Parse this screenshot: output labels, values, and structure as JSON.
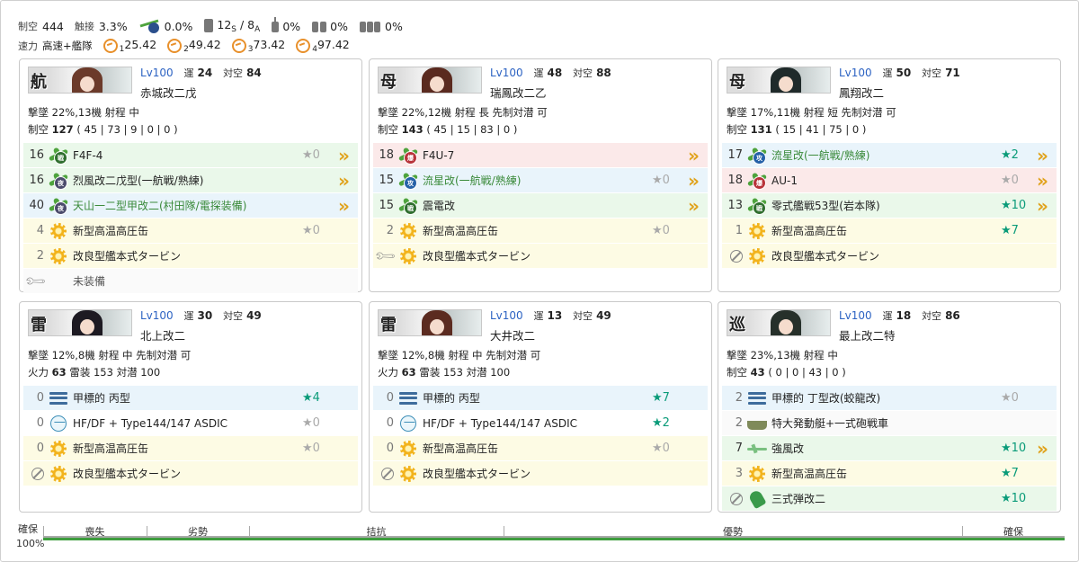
{
  "summary": {
    "air_label": "制空",
    "air": "444",
    "contact_label": "触接",
    "contact": "3.3%",
    "aa_icon_pct": "0.0%",
    "tp_pre": "12",
    "tp_s": "S",
    "tp_mid": "/ 8",
    "tp_a": "A",
    "drum1": "0%",
    "drum2": "0%",
    "drum3": "0%",
    "speed_label": "速力",
    "speed": "高速+艦隊",
    "ae": [
      {
        "i": "1",
        "v": "25.42"
      },
      {
        "i": "2",
        "v": "49.42"
      },
      {
        "i": "3",
        "v": "73.42"
      },
      {
        "i": "4",
        "v": "97.42"
      }
    ]
  },
  "ships": [
    {
      "banner": "航",
      "face": "#6b3a2a",
      "lv": "Lv100",
      "luck_k": "運",
      "luck": "24",
      "aa_k": "対空",
      "aa": "84",
      "name": "赤城改二戊",
      "line1": "撃墜 22%,13機  射程 中",
      "line2_k": "制空",
      "line2_v": "127",
      "line2_rest": "( 45 | 73 | 9 | 0 | 0 )",
      "slots": [
        {
          "c": "16",
          "icon": "plane",
          "badge": "戦",
          "bc": "g",
          "name": "F4F-4",
          "star": "★0",
          "sc": "gray",
          "chev": "»",
          "bg": "g"
        },
        {
          "c": "16",
          "icon": "plane",
          "badge": "夜戦",
          "bc": "k",
          "name": "烈風改二戊型(一航戦/熟練)",
          "star": "",
          "sc": "gray",
          "chev": "»",
          "bg": "g"
        },
        {
          "c": "40",
          "icon": "plane",
          "badge": "夜攻",
          "bc": "k",
          "name": "天山一二型甲改二(村田隊/電探装備)",
          "green": true,
          "star": "",
          "sc": "gray",
          "chev": "»",
          "bg": "b"
        },
        {
          "c": "4",
          "icon": "gear",
          "name": "新型高温高圧缶",
          "star": "★0",
          "sc": "gray",
          "chev": "",
          "bg": "y",
          "muted": true
        },
        {
          "c": "2",
          "icon": "gear",
          "name": "改良型艦本式タービン",
          "star": "",
          "sc": "gray",
          "chev": "",
          "bg": "y",
          "muted": true
        },
        {
          "c": "",
          "icon": "wrench",
          "name": "未装備",
          "star": "",
          "sc": "gray",
          "chev": "",
          "bg": "w",
          "empty": true
        }
      ]
    },
    {
      "banner": "母",
      "face": "#5a2a1f",
      "lv": "Lv100",
      "luck_k": "運",
      "luck": "48",
      "aa_k": "対空",
      "aa": "88",
      "name": "瑞鳳改二乙",
      "line1": "撃墜 22%,12機  射程 長  先制対潜 可",
      "line2_k": "制空",
      "line2_v": "143",
      "line2_rest": "( 45 | 15 | 83 | 0 )",
      "slots": [
        {
          "c": "18",
          "icon": "plane",
          "badge": "爆",
          "bc": "r",
          "name": "F4U-7",
          "star": "",
          "sc": "gray",
          "chev": "»",
          "bg": "r"
        },
        {
          "c": "15",
          "icon": "plane",
          "badge": "攻",
          "bc": "b",
          "name": "流星改(一航戦/熟練)",
          "green": true,
          "star": "★0",
          "sc": "gray",
          "chev": "»",
          "bg": "b"
        },
        {
          "c": "15",
          "icon": "plane",
          "badge": "戦",
          "bc": "g",
          "name": "震電改",
          "star": "",
          "sc": "gray",
          "chev": "»",
          "bg": "g"
        },
        {
          "c": "2",
          "icon": "gear",
          "name": "新型高温高圧缶",
          "star": "★0",
          "sc": "gray",
          "chev": "",
          "bg": "y",
          "muted": true
        },
        {
          "c": "",
          "icon": "wrench",
          "name": "改良型艦本式タービン",
          "star": "",
          "sc": "gray",
          "chev": "",
          "bg": "y"
        }
      ]
    },
    {
      "banner": "母",
      "face": "#1f2a2a",
      "lv": "Lv100",
      "luck_k": "運",
      "luck": "50",
      "aa_k": "対空",
      "aa": "71",
      "name": "鳳翔改二",
      "line1": "撃墜 17%,11機  射程 短  先制対潜 可",
      "line2_k": "制空",
      "line2_v": "131",
      "line2_rest": "( 15 | 41 | 75 | 0 )",
      "slots": [
        {
          "c": "17",
          "icon": "plane",
          "badge": "攻",
          "bc": "b",
          "name": "流星改(一航戦/熟練)",
          "green": true,
          "star": "★2",
          "sc": "teal",
          "chev": "»",
          "bg": "b"
        },
        {
          "c": "18",
          "icon": "plane",
          "badge": "爆",
          "bc": "r",
          "name": "AU-1",
          "star": "★0",
          "sc": "gray",
          "chev": "»",
          "bg": "r"
        },
        {
          "c": "13",
          "icon": "plane",
          "badge": "戦",
          "bc": "g",
          "name": "零式艦戦53型(岩本隊)",
          "star": "★10",
          "sc": "teal",
          "chev": "»",
          "bg": "g"
        },
        {
          "c": "1",
          "icon": "gear",
          "name": "新型高温高圧缶",
          "star": "★7",
          "sc": "teal",
          "chev": "",
          "bg": "y",
          "muted": true
        },
        {
          "c": "",
          "icon": "noentry",
          "name": "改良型艦本式タービン",
          "star": "",
          "sc": "gray",
          "chev": "",
          "bg": "y"
        }
      ]
    },
    {
      "banner": "雷",
      "face": "#1d1a22",
      "lv": "Lv100",
      "luck_k": "運",
      "luck": "30",
      "aa_k": "対空",
      "aa": "49",
      "name": "北上改二",
      "line1": "撃墜 12%,8機  射程 中  先制対潜 可",
      "line2_k": "火力",
      "line2_v": "63",
      "line2_rest": "雷装 153  対潜 100",
      "slots": [
        {
          "c": "0",
          "icon": "depth",
          "name": "甲標的 丙型",
          "star": "★4",
          "sc": "teal",
          "chev": "",
          "bg": "b",
          "muted": true
        },
        {
          "c": "0",
          "icon": "sonar",
          "name": "HF/DF + Type144/147 ASDIC",
          "star": "★0",
          "sc": "gray",
          "chev": "",
          "bg": "n",
          "muted": true
        },
        {
          "c": "0",
          "icon": "gear",
          "name": "新型高温高圧缶",
          "star": "★0",
          "sc": "gray",
          "chev": "",
          "bg": "y",
          "muted": true
        },
        {
          "c": "",
          "icon": "noentry",
          "name": "改良型艦本式タービン",
          "star": "",
          "sc": "gray",
          "chev": "",
          "bg": "y"
        }
      ]
    },
    {
      "banner": "雷",
      "face": "#5b2b20",
      "lv": "Lv100",
      "luck_k": "運",
      "luck": "13",
      "aa_k": "対空",
      "aa": "49",
      "name": "大井改二",
      "line1": "撃墜 12%,8機  射程 中  先制対潜 可",
      "line2_k": "火力",
      "line2_v": "63",
      "line2_rest": "雷装 153  対潜 100",
      "slots": [
        {
          "c": "0",
          "icon": "depth",
          "name": "甲標的 丙型",
          "star": "★7",
          "sc": "teal",
          "chev": "",
          "bg": "b",
          "muted": true
        },
        {
          "c": "0",
          "icon": "sonar",
          "name": "HF/DF + Type144/147 ASDIC",
          "star": "★2",
          "sc": "teal",
          "chev": "",
          "bg": "n",
          "muted": true
        },
        {
          "c": "0",
          "icon": "gear",
          "name": "新型高温高圧缶",
          "star": "★0",
          "sc": "gray",
          "chev": "",
          "bg": "y",
          "muted": true
        },
        {
          "c": "",
          "icon": "noentry",
          "name": "改良型艦本式タービン",
          "star": "",
          "sc": "gray",
          "chev": "",
          "bg": "y"
        }
      ]
    },
    {
      "banner": "巡",
      "face": "#26302a",
      "lv": "Lv100",
      "luck_k": "運",
      "luck": "18",
      "aa_k": "対空",
      "aa": "86",
      "name": "最上改二特",
      "line1": "撃墜 23%,13機  射程 中",
      "line2_k": "制空",
      "line2_v": "43",
      "line2_rest": "( 0 | 0 | 43 | 0 )",
      "slots": [
        {
          "c": "2",
          "icon": "depth",
          "name": "甲標的 丁型改(蛟龍改)",
          "star": "★0",
          "sc": "gray",
          "chev": "",
          "bg": "b",
          "muted": true
        },
        {
          "c": "2",
          "icon": "landing",
          "name": "特大発動艇+一式砲戦車",
          "star": "",
          "sc": "gray",
          "chev": "",
          "bg": "w",
          "muted": true
        },
        {
          "c": "7",
          "icon": "seaplane",
          "name": "強風改",
          "star": "★10",
          "sc": "teal",
          "chev": "»",
          "bg": "g"
        },
        {
          "c": "3",
          "icon": "gear",
          "name": "新型高温高圧缶",
          "star": "★7",
          "sc": "teal",
          "chev": "",
          "bg": "y",
          "muted": true
        },
        {
          "c": "",
          "icon": "noentry",
          "icon2": "shell",
          "name": "三式弾改二",
          "star": "★10",
          "sc": "teal",
          "chev": "",
          "bg": "g"
        }
      ]
    }
  ],
  "bar": {
    "left_top": "確保",
    "left_bottom": "100%",
    "right": "確保",
    "segs": [
      "喪失",
      "劣勢",
      "拮抗",
      "優勢"
    ],
    "fill_fraction": 1.0
  }
}
